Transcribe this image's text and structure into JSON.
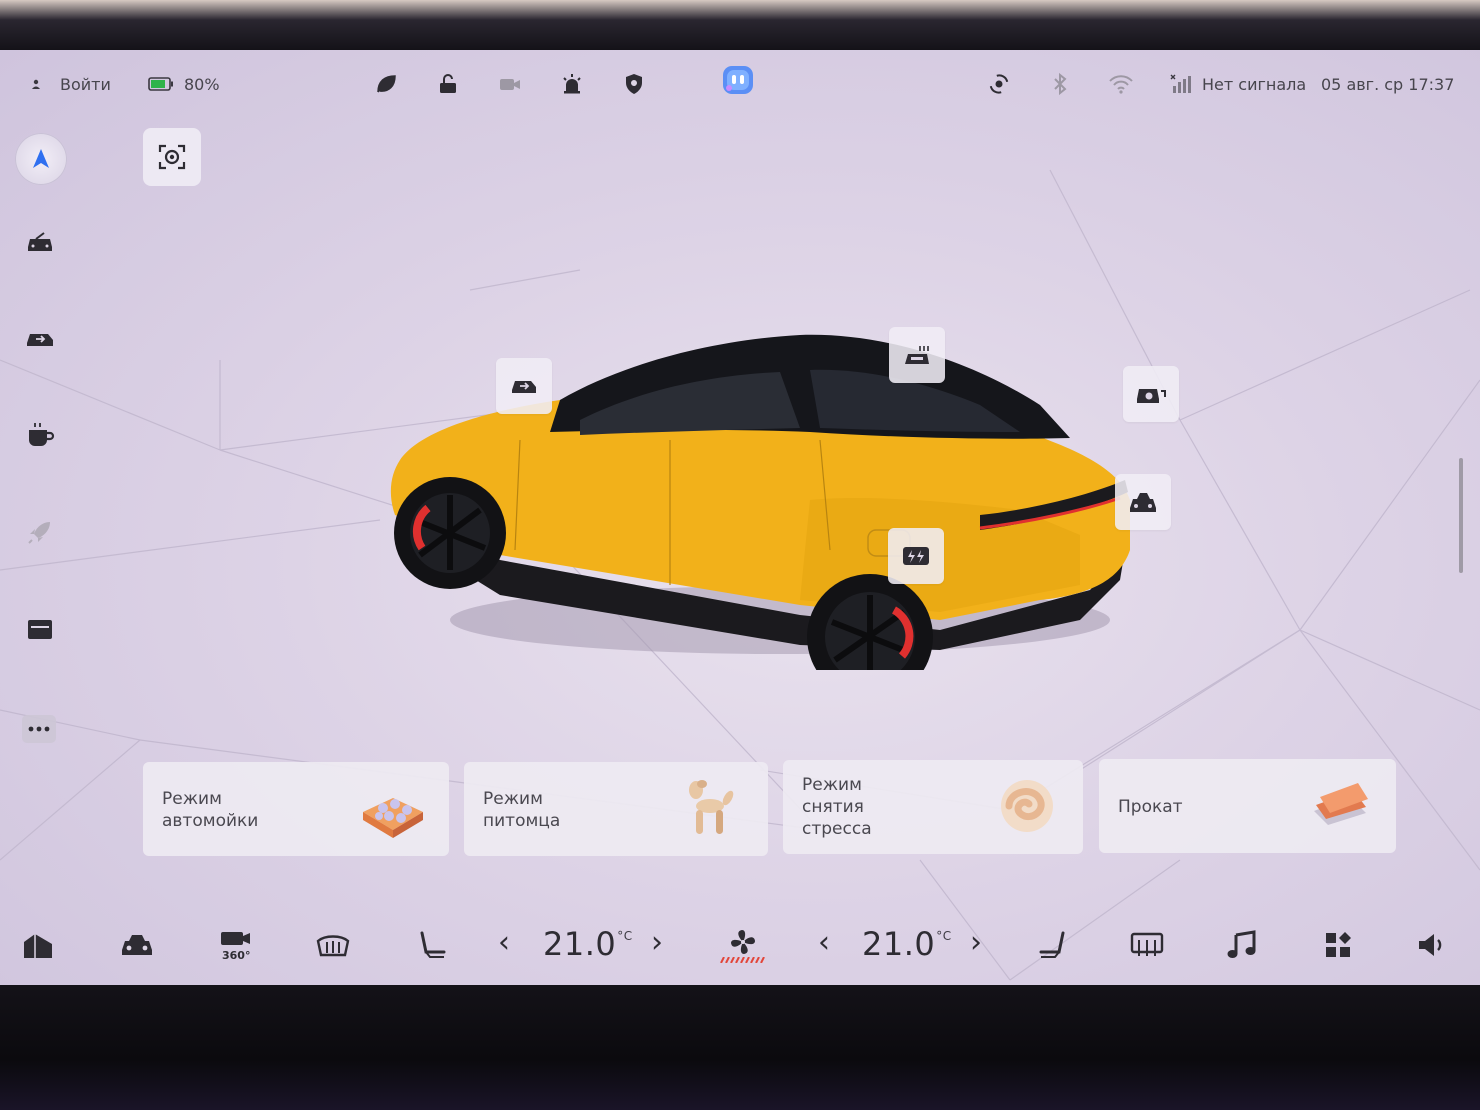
{
  "status_bar": {
    "login_label": "Войти",
    "battery_percent": "80%",
    "battery_level": 0.8,
    "signal_text": "Нет сигнала",
    "datetime": "05 авг. ср 17:37",
    "icons": [
      "user-icon",
      "battery-icon",
      "leaf-icon",
      "unlock-icon",
      "dashcam-icon",
      "alarm-icon",
      "shield-icon",
      "assistant-icon",
      "hotspot-icon",
      "bluetooth-icon",
      "wifi-icon",
      "cellular-icon"
    ]
  },
  "left_rail": {
    "items": [
      "navigation-icon",
      "scan-icon",
      "car-wash-icon",
      "tailgate-icon",
      "coffee-icon",
      "launch-icon",
      "glovebox-icon",
      "more-icon"
    ]
  },
  "vehicle": {
    "body_color": "#F2B11A",
    "hotspots": [
      "front-trunk-icon",
      "sunroof-icon",
      "charge-port-cap-icon",
      "trunk-icon",
      "charging-icon"
    ]
  },
  "modes": [
    {
      "label": "Режим\nавтомойки",
      "art": "car-wash-sponge"
    },
    {
      "label": "Режим\nпитомца",
      "art": "balloon-dog"
    },
    {
      "label": "Режим\nснятия\nстресса",
      "art": "relax-swirl"
    },
    {
      "label": "Прокат",
      "art": "rental-cards"
    }
  ],
  "dock": {
    "left_temp": "21.0",
    "right_temp": "21.0",
    "temp_unit": "°C",
    "left_arrow_prev": "‹",
    "left_arrow_next": "›",
    "right_arrow_prev": "‹",
    "right_arrow_next": "›",
    "icons": [
      "home-icon",
      "car-icon",
      "camera-360-icon",
      "front-defrost-icon",
      "driver-seat-icon",
      "fan-icon",
      "passenger-seat-icon",
      "rear-defrost-icon",
      "music-icon",
      "apps-icon",
      "volume-icon"
    ],
    "camera_label": "360°",
    "accent": "#E2463A"
  }
}
